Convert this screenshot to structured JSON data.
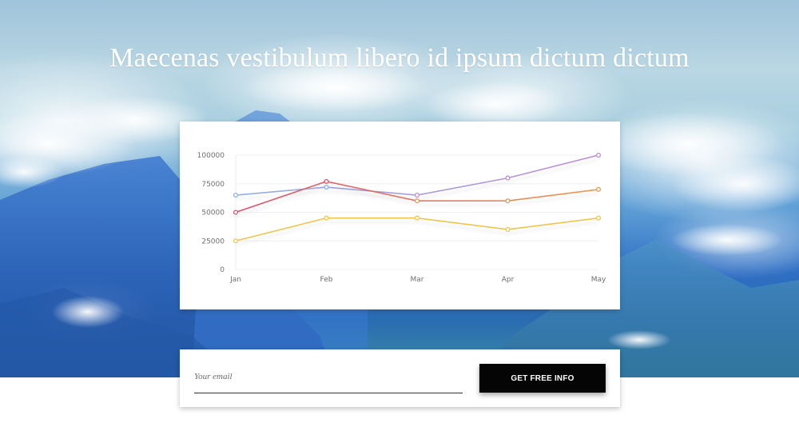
{
  "hero": {
    "title": "Maecenas vestibulum libero id ipsum dictum dictum"
  },
  "form": {
    "email_placeholder": "Your email",
    "submit_label": "GET FREE INFO"
  },
  "colors": {
    "button_bg": "#050505",
    "card_bg": "#ffffff"
  },
  "chart_data": {
    "type": "line",
    "categories": [
      "Jan",
      "Feb",
      "Mar",
      "Apr",
      "May"
    ],
    "ylim": [
      0,
      100000
    ],
    "yticks": [
      0,
      25000,
      50000,
      75000,
      100000
    ],
    "ytick_labels": [
      "0",
      "25000",
      "50000",
      "75000",
      "100000"
    ],
    "grid": true,
    "series": [
      {
        "values": [
          65000,
          72000,
          65000,
          80000,
          100000
        ],
        "color_start": "#8fb0e8",
        "color_end": "#c08ad8"
      },
      {
        "values": [
          50000,
          77000,
          60000,
          60000,
          70000
        ],
        "color_start": "#e0506c",
        "color_end": "#ea9a50"
      },
      {
        "values": [
          25000,
          45000,
          45000,
          35000,
          45000
        ],
        "color": "#f1c44a"
      }
    ]
  }
}
